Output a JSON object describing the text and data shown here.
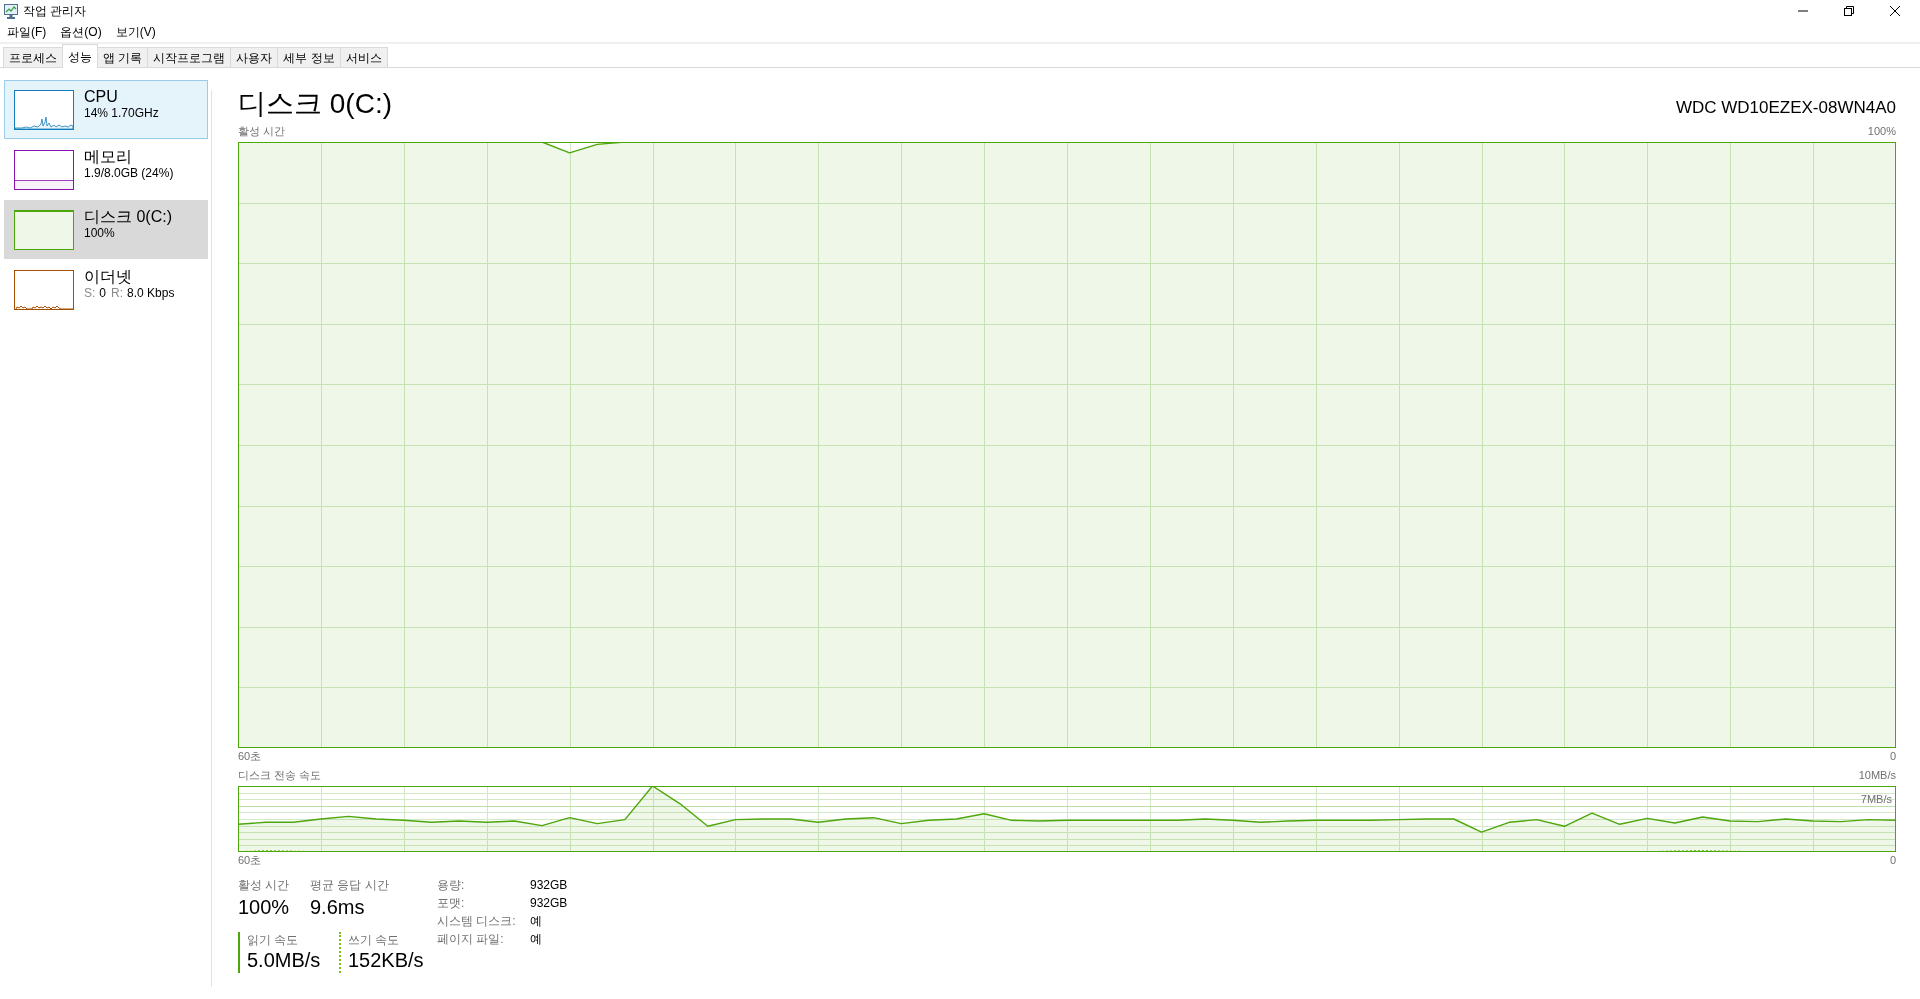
{
  "window": {
    "title": "작업 관리자"
  },
  "menu": [
    {
      "label": "파일(F)"
    },
    {
      "label": "옵션(O)"
    },
    {
      "label": "보기(V)"
    }
  ],
  "tabs": [
    {
      "label": "프로세스",
      "selected": false
    },
    {
      "label": "성능",
      "selected": true
    },
    {
      "label": "앱 기록",
      "selected": false
    },
    {
      "label": "시작프로그램",
      "selected": false
    },
    {
      "label": "사용자",
      "selected": false
    },
    {
      "label": "세부 정보",
      "selected": false
    },
    {
      "label": "서비스",
      "selected": false
    }
  ],
  "sidebar": {
    "items": [
      {
        "kind": "cpu",
        "title": "CPU",
        "subtitle": "14% 1.70GHz",
        "hovered": true,
        "selected": false
      },
      {
        "kind": "memory",
        "title": "메모리",
        "subtitle": "1.9/8.0GB (24%)",
        "hovered": false,
        "selected": false
      },
      {
        "kind": "disk",
        "title": "디스크 0(C:)",
        "subtitle": "100%",
        "hovered": false,
        "selected": true
      },
      {
        "kind": "ethernet",
        "title": "이더넷",
        "readings": [
          {
            "label": "S:",
            "value": "0"
          },
          {
            "label": "R:",
            "value": "8.0 Kbps"
          }
        ],
        "hovered": false,
        "selected": false
      }
    ]
  },
  "detail": {
    "title": "디스크 0(C:)",
    "model": "WDC WD10EZEX-08WN4A0",
    "active_time_graph": {
      "title": "활성 시간",
      "max_label": "100%",
      "start_label": "60초",
      "end_label": "0"
    },
    "transfer_rate_graph": {
      "title": "디스크 전송 속도",
      "max_label": "10MB/s",
      "marker_label": "7MB/s",
      "start_label": "60초",
      "end_label": "0"
    },
    "stats": [
      {
        "label": "활성 시간",
        "value": "100%"
      },
      {
        "label": "평균 응답 시간",
        "value": "9.6ms"
      }
    ],
    "speeds": [
      {
        "kind": "read",
        "label": "읽기 속도",
        "value": "5.0MB/s",
        "color": "#4da60c"
      },
      {
        "kind": "write",
        "label": "쓰기 속도",
        "value": "152KB/s",
        "color": "#7cbf1e"
      }
    ],
    "properties": [
      {
        "label": "용량:",
        "value": "932GB"
      },
      {
        "label": "포맷:",
        "value": "932GB"
      },
      {
        "label": "시스템 디스크:",
        "value": "예"
      },
      {
        "label": "페이지 파일:",
        "value": "예"
      }
    ]
  }
}
